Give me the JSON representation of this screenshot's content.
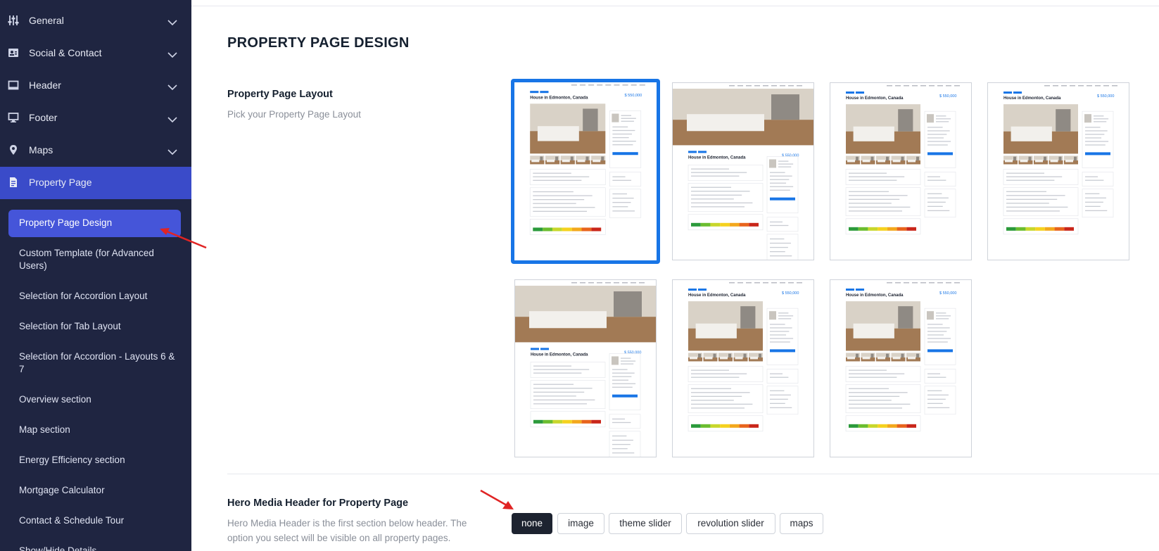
{
  "sidebar": {
    "items": [
      {
        "label": "General",
        "icon": "sliders-icon"
      },
      {
        "label": "Social & Contact",
        "icon": "contact-card-icon"
      },
      {
        "label": "Header",
        "icon": "header-layout-icon"
      },
      {
        "label": "Footer",
        "icon": "monitor-icon"
      },
      {
        "label": "Maps",
        "icon": "map-pin-icon"
      },
      {
        "label": "Property Page",
        "icon": "document-icon"
      }
    ],
    "submenu": {
      "active": "Property Page Design",
      "items": [
        "Custom Template (for Advanced Users)",
        "Selection for Accordion Layout",
        "Selection for Tab Layout",
        "Selection for Accordion - Layouts 6 & 7",
        "Overview section",
        "Map section",
        "Energy Efficiency section",
        "Mortgage Calculator",
        "Contact & Schedule Tour",
        "Show/Hide Details"
      ]
    }
  },
  "main": {
    "title": "PROPERTY PAGE DESIGN",
    "layout_section": {
      "title": "Property Page Layout",
      "description": "Pick your Property Page Layout",
      "selected_index": 0,
      "thumbnail_heading": "House in Edmonton, Canada",
      "thumbnail_price": "$ 550,000"
    },
    "hero_section": {
      "title": "Hero Media Header for Property Page",
      "description": "Hero Media Header is the first section below header. The option you select will be visible on all property pages.",
      "options": [
        "none",
        "image",
        "theme slider",
        "revolution slider",
        "maps"
      ],
      "selected": "none"
    }
  },
  "colors": {
    "sidebar_bg": "#1f2541",
    "active_nav": "#3a4bc9",
    "active_sub": "#4555d9",
    "selected_border": "#1875e6",
    "annotation_arrow": "#e02424"
  }
}
